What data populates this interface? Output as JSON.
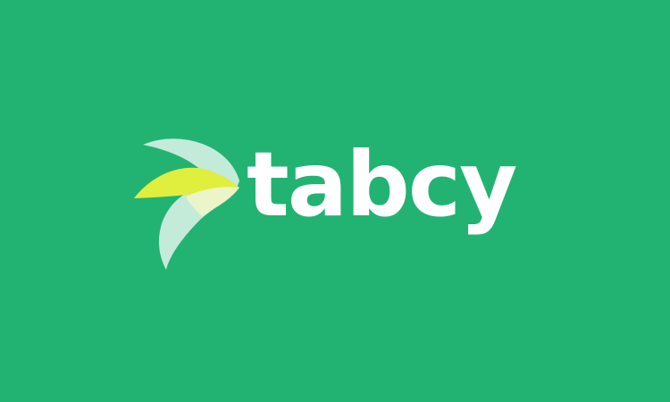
{
  "brand": {
    "name": "tabcy",
    "logo_icon": "bird-beak-logo-icon"
  },
  "colors": {
    "background": "#22b373",
    "wordmark": "#ffffff",
    "logo_pale": "#d6efe6",
    "logo_yellow": "#e0ee3e",
    "logo_light_yellow": "#eef6c8"
  }
}
